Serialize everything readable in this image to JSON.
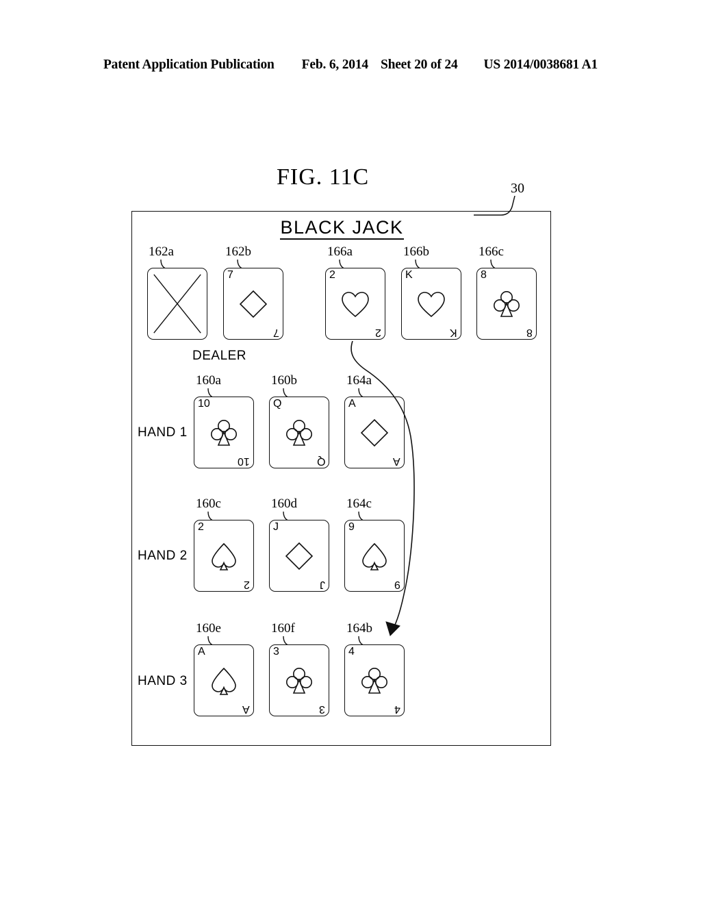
{
  "header": {
    "publication": "Patent Application Publication",
    "date": "Feb. 6, 2014",
    "sheet": "Sheet 20 of 24",
    "number": "US 2014/0038681 A1"
  },
  "figure": {
    "title": "FIG. 11C",
    "screen_ref": "30"
  },
  "screen": {
    "game_title": "BLACK JACK",
    "dealer_label": "DEALER",
    "hand_labels": [
      "HAND 1",
      "HAND 2",
      "HAND 3"
    ]
  },
  "cards": {
    "dealer": [
      {
        "ref": "162a",
        "rank": "",
        "suit": "face-down",
        "face_down": true
      },
      {
        "ref": "162b",
        "rank": "7",
        "suit": "diamond",
        "face_down": false
      }
    ],
    "dealer_extra": [
      {
        "ref": "166a",
        "rank": "2",
        "suit": "heart",
        "face_down": false
      },
      {
        "ref": "166b",
        "rank": "K",
        "suit": "heart",
        "face_down": false
      },
      {
        "ref": "166c",
        "rank": "8",
        "suit": "club",
        "face_down": false
      }
    ],
    "hand1": [
      {
        "ref": "160a",
        "rank": "10",
        "suit": "club",
        "face_down": false
      },
      {
        "ref": "160b",
        "rank": "Q",
        "suit": "club",
        "face_down": false
      },
      {
        "ref": "164a",
        "rank": "A",
        "suit": "diamond",
        "face_down": false
      }
    ],
    "hand2": [
      {
        "ref": "160c",
        "rank": "2",
        "suit": "spade",
        "face_down": false
      },
      {
        "ref": "160d",
        "rank": "J",
        "suit": "diamond",
        "face_down": false
      },
      {
        "ref": "164c",
        "rank": "9",
        "suit": "spade",
        "face_down": false
      }
    ],
    "hand3": [
      {
        "ref": "160e",
        "rank": "A",
        "suit": "spade",
        "face_down": false
      },
      {
        "ref": "160f",
        "rank": "3",
        "suit": "club",
        "face_down": false
      },
      {
        "ref": "164b",
        "rank": "4",
        "suit": "club",
        "face_down": false
      }
    ]
  },
  "colors": {
    "ink": "#111111",
    "paper": "#ffffff"
  }
}
